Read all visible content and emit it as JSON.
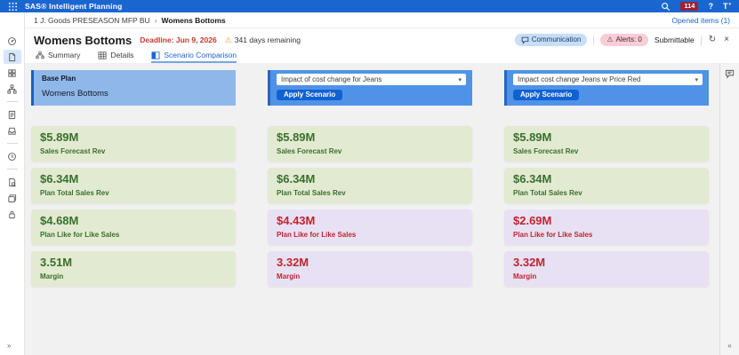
{
  "topbar": {
    "title": "SAS® Intelligent Planning",
    "notification_count": "114",
    "help_label": "?",
    "avatar_label": "T"
  },
  "sidebar": {
    "icons": [
      "gauge-icon",
      "document-icon",
      "grid-icon",
      "hierarchy-icon",
      "file-icon",
      "tray-icon",
      "clock-icon",
      "doc-search-icon",
      "layers-icon",
      "lock-icon"
    ],
    "selected_index": 1,
    "expand_glyph": "»"
  },
  "breadcrumb": {
    "parent": "1 J. Goods PRESEASON MFP BU",
    "separator": "›",
    "current": "Womens Bottoms",
    "opened_items": "Opened items (1)"
  },
  "title_row": {
    "title": "Womens Bottoms",
    "deadline": "Deadline: Jun 9, 2026",
    "warning_glyph": "⚠",
    "days_remaining": "341 days remaining",
    "communication": "Communication",
    "alert_glyph": "⚠",
    "alerts": "Alerts: 0",
    "submittable": "Submittable",
    "refresh_glyph": "↻",
    "close_glyph": "×"
  },
  "tabs": [
    {
      "label": "Summary",
      "active": false
    },
    {
      "label": "Details",
      "active": false
    },
    {
      "label": "Scenario Comparison",
      "active": true
    }
  ],
  "columns": [
    {
      "type": "base-plan",
      "header": {
        "title": "Base Plan",
        "subtitle": "Womens Bottoms"
      },
      "cards": [
        {
          "value": "$5.89M",
          "label": "Sales Forecast Rev",
          "state": "good"
        },
        {
          "value": "$6.34M",
          "label": "Plan Total Sales Rev",
          "state": "good"
        },
        {
          "value": "$4.68M",
          "label": "Plan Like for Like Sales",
          "state": "good"
        },
        {
          "value": "3.51M",
          "label": "Margin",
          "state": "good"
        }
      ]
    },
    {
      "type": "scenario",
      "header": {
        "scenario": "Impact of cost change for Jeans",
        "apply_label": "Apply Scenario"
      },
      "cards": [
        {
          "value": "$5.89M",
          "label": "Sales Forecast Rev",
          "state": "good"
        },
        {
          "value": "$6.34M",
          "label": "Plan Total Sales Rev",
          "state": "good"
        },
        {
          "value": "$4.43M",
          "label": "Plan Like for Like Sales",
          "state": "bad"
        },
        {
          "value": "3.32M",
          "label": "Margin",
          "state": "bad"
        }
      ]
    },
    {
      "type": "scenario",
      "header": {
        "scenario": "Impact cost change Jeans w Price Red",
        "apply_label": "Apply Scenario"
      },
      "cards": [
        {
          "value": "$5.89M",
          "label": "Sales Forecast Rev",
          "state": "good"
        },
        {
          "value": "$6.34M",
          "label": "Plan Total Sales Rev",
          "state": "good"
        },
        {
          "value": "$2.69M",
          "label": "Plan Like for Like Sales",
          "state": "bad"
        },
        {
          "value": "3.32M",
          "label": "Margin",
          "state": "bad"
        }
      ]
    }
  ],
  "rail": {
    "collapse_glyph": "«"
  },
  "colors": {
    "header_blue": "#1A66D1",
    "base_panel_blue": "#8FB8E9",
    "scenario_panel_blue": "#4F93E9",
    "panel_border_blue": "#1C5FC0",
    "apply_button_blue": "#1161D2",
    "good_card_bg": "#E3EAD2",
    "good_card_text": "#38702C",
    "bad_card_bg": "#E8E1F3",
    "bad_card_text": "#C2242E",
    "deadline_red": "#C5382C",
    "badge_red": "#9E2137",
    "communication_pill_bg": "#C7DDF8",
    "alerts_pill_bg": "#F6CED7",
    "content_bg": "#F1F1F2"
  }
}
